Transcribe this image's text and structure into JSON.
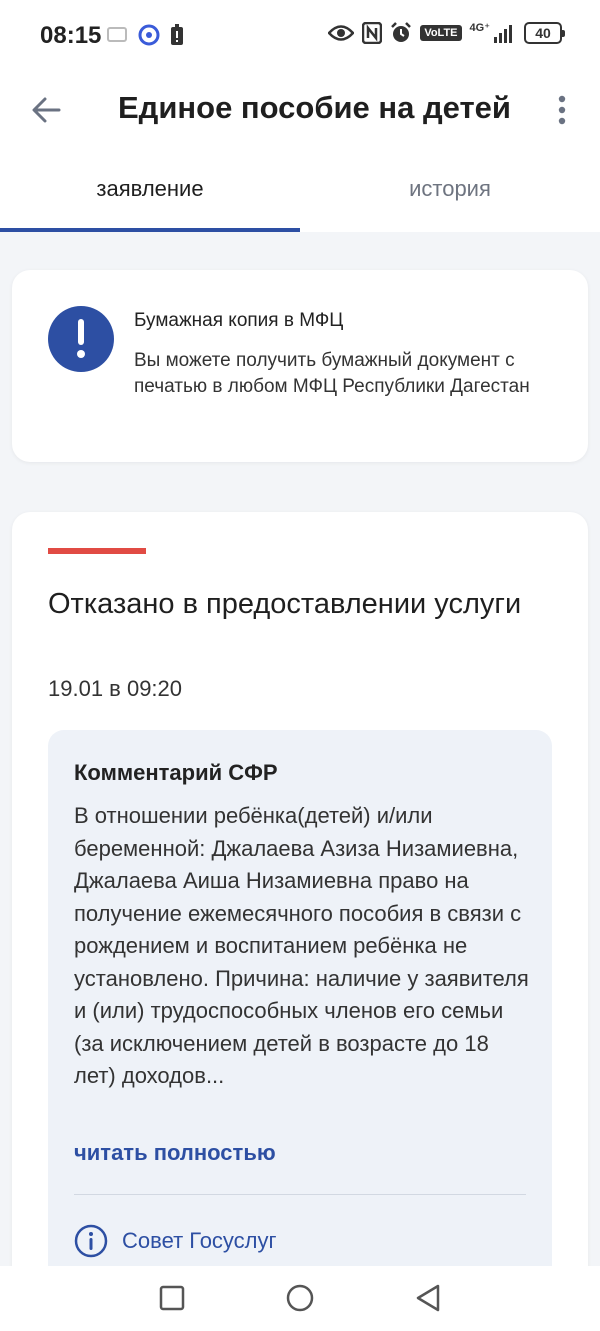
{
  "status_bar": {
    "time": "08:15",
    "network": "4G⁺",
    "volte": "VoLTE",
    "battery": "40"
  },
  "header": {
    "title": "Единое пособие на детей"
  },
  "tabs": [
    {
      "label": "заявление"
    },
    {
      "label": "история"
    }
  ],
  "info_card": {
    "title": "Бумажная копия в МФЦ",
    "text": "Вы можете получить бумажный документ с печатью в любом МФЦ Республики Дагестан"
  },
  "status_card": {
    "heading": "Отказано в предоставлении услуги",
    "date": "19.01 в 09:20",
    "comment": {
      "title": "Комментарий СФР",
      "text": "В отношении ребёнка(детей) и/или беременной: Джалаева Азиза Низамиевна, Джалаева Аиша Низамиевна право на получение ежемесячного пособия в связи с рождением и воспитанием ребёнка не установлено. Причина: наличие у заявителя и (или) трудоспособных членов его семьи (за исключением детей в возрасте до 18 лет) доходов...",
      "read_more": "читать полностью",
      "advice_label": "Совет Госуслуг"
    }
  },
  "colors": {
    "accent": "#2d4fa3",
    "reject": "#e14b44"
  }
}
